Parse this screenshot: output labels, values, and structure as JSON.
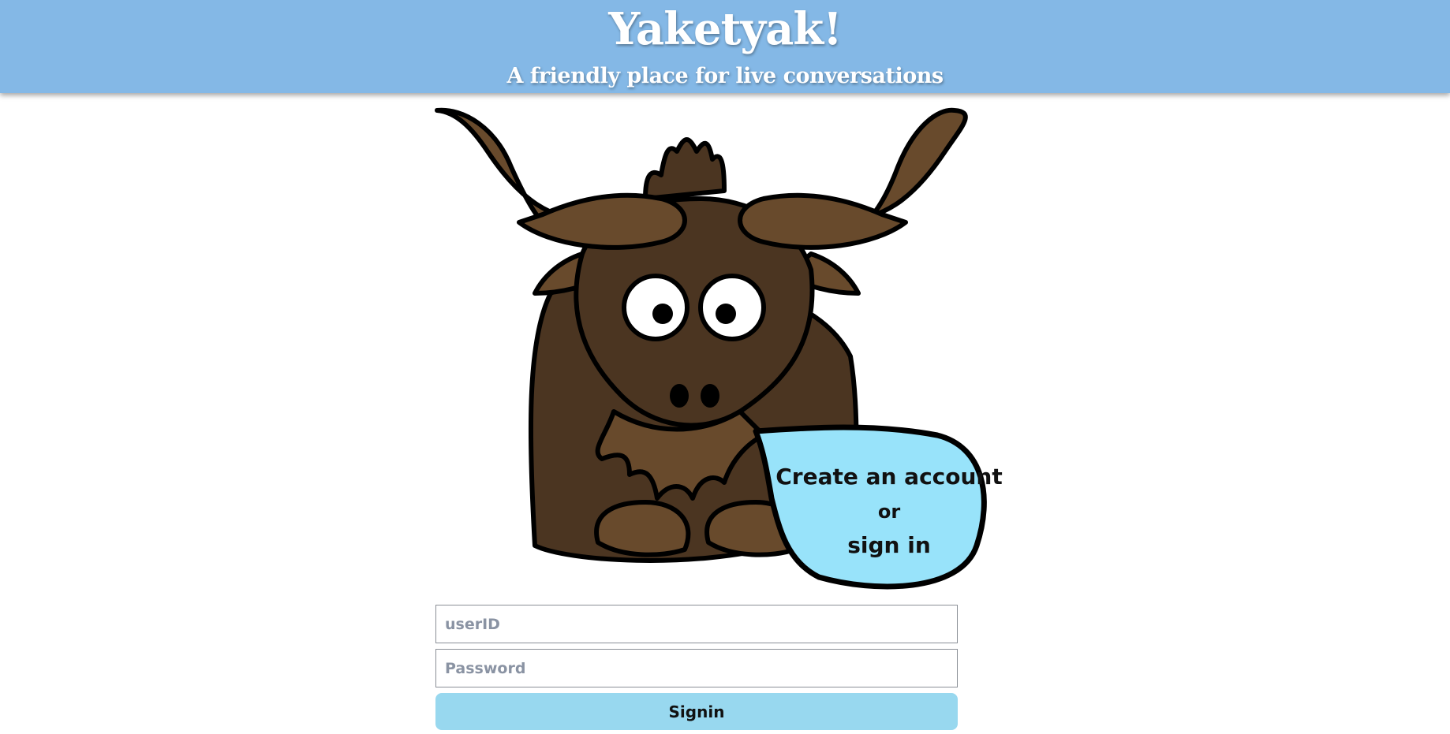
{
  "header": {
    "title": "Yaketyak!",
    "subtitle": "A friendly place for live conversations",
    "background_color": "#84b8e6"
  },
  "hero": {
    "image": "yak-cartoon",
    "speech_bubble": {
      "line1": "Create an account",
      "line2": "or",
      "line3": "sign in",
      "color": "#98e3fa"
    }
  },
  "login_form": {
    "userid_placeholder": "userID",
    "password_placeholder": "Password",
    "signin_label": "Signin",
    "button_color": "#98d8ef"
  }
}
